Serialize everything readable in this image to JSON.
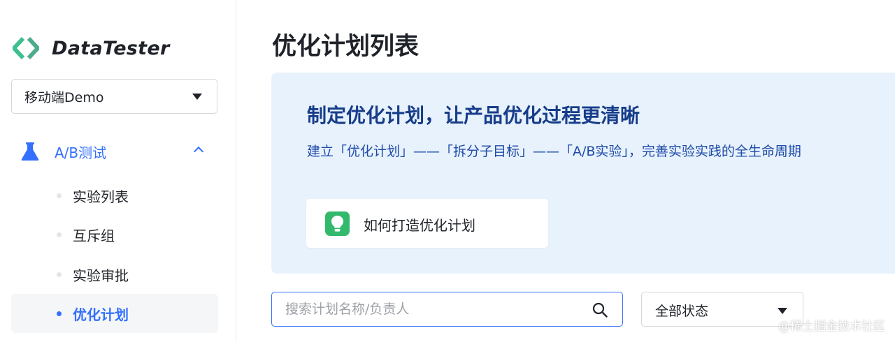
{
  "sidebar": {
    "logo_text": "DataTester",
    "project_select": {
      "value": "移动端Demo"
    },
    "nav_group": {
      "label": "A/B测试",
      "expanded": true
    },
    "items": [
      {
        "label": "实验列表",
        "active": false
      },
      {
        "label": "互斥组",
        "active": false
      },
      {
        "label": "实验审批",
        "active": false
      },
      {
        "label": "优化计划",
        "active": true
      }
    ]
  },
  "main": {
    "page_title": "优化计划列表",
    "banner": {
      "title": "制定优化计划，让产品优化过程更清晰",
      "subtitle": "建立「优化计划」——「拆分子目标」——「A/B实验」，完善实验实践的全生命周期",
      "how_to_label": "如何打造优化计划"
    },
    "search": {
      "placeholder": "搜索计划名称/负责人",
      "value": ""
    },
    "status_filter": {
      "value": "全部状态"
    }
  },
  "watermark": "@稀土掘金技术社区",
  "colors": {
    "accent": "#3370ff",
    "banner_bg": "#e8f2fd",
    "banner_title": "#173d8a",
    "bulb_green": "#33b96b",
    "logo_green": "#3ec08e"
  },
  "icons": [
    "datatester-logo-icon",
    "flask-icon",
    "chevron-up-icon",
    "caret-down-icon",
    "lightbulb-icon",
    "search-icon"
  ]
}
